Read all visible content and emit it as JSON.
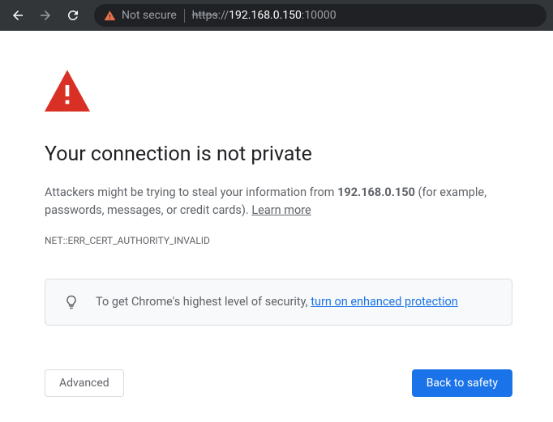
{
  "toolbar": {
    "not_secure_label": "Not secure",
    "url_scheme": "https",
    "url_sep": "://",
    "url_host": "192.168.0.150",
    "url_port": ":10000"
  },
  "page": {
    "heading": "Your connection is not private",
    "desc_pre": "Attackers might be trying to steal your information from ",
    "desc_host": "192.168.0.150",
    "desc_post": " (for example, passwords, messages, or credit cards). ",
    "learn_more": "Learn more",
    "error_code": "NET::ERR_CERT_AUTHORITY_INVALID",
    "promo_pre": "To get Chrome's highest level of security, ",
    "promo_link": "turn on enhanced protection",
    "btn_advanced": "Advanced",
    "btn_safety": "Back to safety"
  }
}
